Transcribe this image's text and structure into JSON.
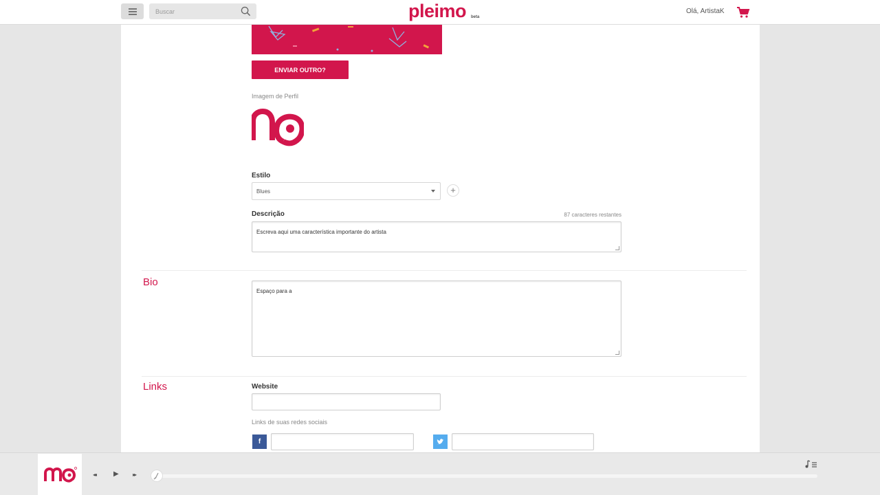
{
  "header": {
    "search_placeholder": "Buscar",
    "brand": "pleimo",
    "brand_badge": "beta",
    "greeting": "Olá, ArtistaK",
    "icons": [
      "menu-icon",
      "search-icon",
      "cart-icon"
    ]
  },
  "form": {
    "resend_button": "ENVIAR OUTRO?",
    "profile_image_label": "Imagem de Perfil",
    "style_label": "Estilo",
    "style_value": "Blues",
    "add_style": "+",
    "description_label": "Descrição",
    "description_counter": "87 caracteres restantes",
    "description_value": "Escreva aqui uma característica importante do artista",
    "bio_section": "Bio",
    "bio_value": "Espaço para a",
    "links_section": "Links",
    "website_label": "Website",
    "website_value": "",
    "social_label": "Links de suas redes sociais",
    "facebook_value": "",
    "twitter_value": ""
  },
  "player": {
    "prev": "◂◂",
    "play": "▶",
    "next": "▸▸",
    "progress": 0
  },
  "colors": {
    "accent": "#d2164c",
    "facebook": "#3b5998",
    "twitter": "#55acee",
    "page_bg": "#e6e6e6"
  }
}
